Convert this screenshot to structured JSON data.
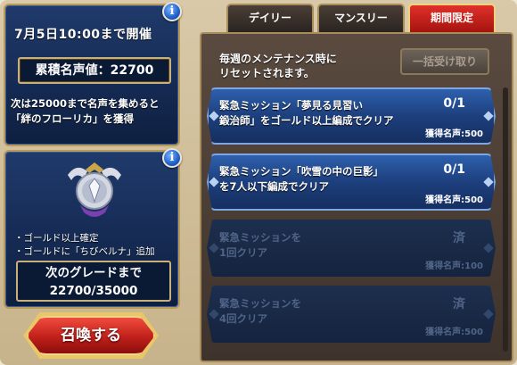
{
  "event": {
    "date_text": "7月5日10:00まで開催",
    "fame_label": "累積名声値：22700",
    "next_reward_line1": "次は25000まで名声を集めると",
    "next_reward_line2": "「絆のフローリカ」を獲得"
  },
  "grade": {
    "perk1": "・ゴールド以上確定",
    "perk2": "・ゴールドに「ちびベルナ」追加",
    "next_label": "次のグレードまで",
    "progress": "22700/35000"
  },
  "summon_button": "召喚する",
  "info_icon_glyph": "i",
  "tabs": [
    {
      "label": "デイリー",
      "active": false
    },
    {
      "label": "マンスリー",
      "active": false
    },
    {
      "label": "期間限定",
      "active": true
    }
  ],
  "reset_note_line1": "毎週のメンテナンス時に",
  "reset_note_line2": "リセットされます。",
  "claim_all": "一括受け取り",
  "missions": [
    {
      "line1": "緊急ミッション「夢見る見習い",
      "line2": "鍛治師」をゴールド以上編成でクリア",
      "progress": "0/1",
      "reward": "獲得名声:500",
      "state": "open"
    },
    {
      "line1": "緊急ミッション「吹雪の中の巨影」",
      "line2": "を7人以下編成でクリア",
      "progress": "0/1",
      "reward": "獲得名声:500",
      "state": "open"
    },
    {
      "line1": "緊急ミッションを",
      "line2": "1回クリア",
      "progress": "済",
      "reward": "獲得名声:100",
      "state": "done"
    },
    {
      "line1": "緊急ミッションを",
      "line2": "4回クリア",
      "progress": "済",
      "reward": "獲得名声:500",
      "state": "done"
    }
  ],
  "colors": {
    "panel_blue": "#1f3a6b",
    "tab_active": "#e0302a",
    "gold_border": "#c9b07a",
    "summon_red": "#c0201a"
  }
}
